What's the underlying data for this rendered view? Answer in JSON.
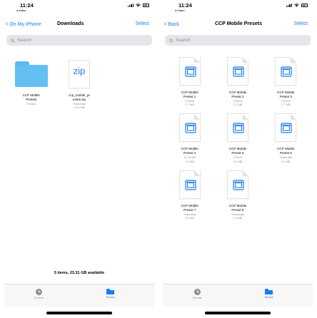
{
  "left": {
    "status": {
      "time": "11:24",
      "back_app": "◂ Safari"
    },
    "nav": {
      "back_label": "On My iPhone",
      "title": "Downloads",
      "select_label": "Select"
    },
    "search": {
      "placeholder": "Search"
    },
    "items": [
      {
        "name": "CCP Mobile\nPresets",
        "meta1": "9 items",
        "meta2": "",
        "icon": "folder-icon"
      },
      {
        "name": "ccp_mobile_pr\nesets.zip",
        "meta1": "Yesterday",
        "meta2": "19.3 MB",
        "icon": "zip-icon",
        "badge": "zip"
      }
    ],
    "footer": "5 items, 23.31 GB available",
    "tabs": {
      "recents": "Recents",
      "browse": "Browse"
    }
  },
  "right": {
    "status": {
      "time": "11:24",
      "back_app": "◂ Safari"
    },
    "nav": {
      "back_label": "Back",
      "title": "CCP Mobile Presets",
      "select_label": "Select"
    },
    "search": {
      "placeholder": "Search"
    },
    "items": [
      {
        "name": "CCP Mobile\nPreset 1",
        "meta1": "7/29/20",
        "meta2": "2.7 MB"
      },
      {
        "name": "CCP Mobile\nPreset 2",
        "meta1": "7/29/20",
        "meta2": "2.1 MB"
      },
      {
        "name": "CCP Mobile\nPreset 3",
        "meta1": "7/29/20",
        "meta2": "2.7 MB"
      },
      {
        "name": "CCP Mobile\nPreset 4",
        "meta1": "11:18 AM",
        "meta2": "1.9 MB"
      },
      {
        "name": "CCP Mobile\nPreset 5",
        "meta1": "7/29/20",
        "meta2": "2.2 MB"
      },
      {
        "name": "CCP Mobile\nPreset 6",
        "meta1": "Yesterday",
        "meta2": "2.5 MB"
      },
      {
        "name": "CCP Mobile\nPreset 7",
        "meta1": "Yesterday",
        "meta2": "2.5 MB"
      },
      {
        "name": "CCP Mobile\nPreset 8",
        "meta1": "Yesterday",
        "meta2": "2.4 MB"
      }
    ],
    "tabs": {
      "recents": "Recents",
      "browse": "Browse"
    }
  },
  "colors": {
    "accent": "#1a7cf5",
    "folder": "#64bff2",
    "secondary_text": "#8e8e93"
  }
}
